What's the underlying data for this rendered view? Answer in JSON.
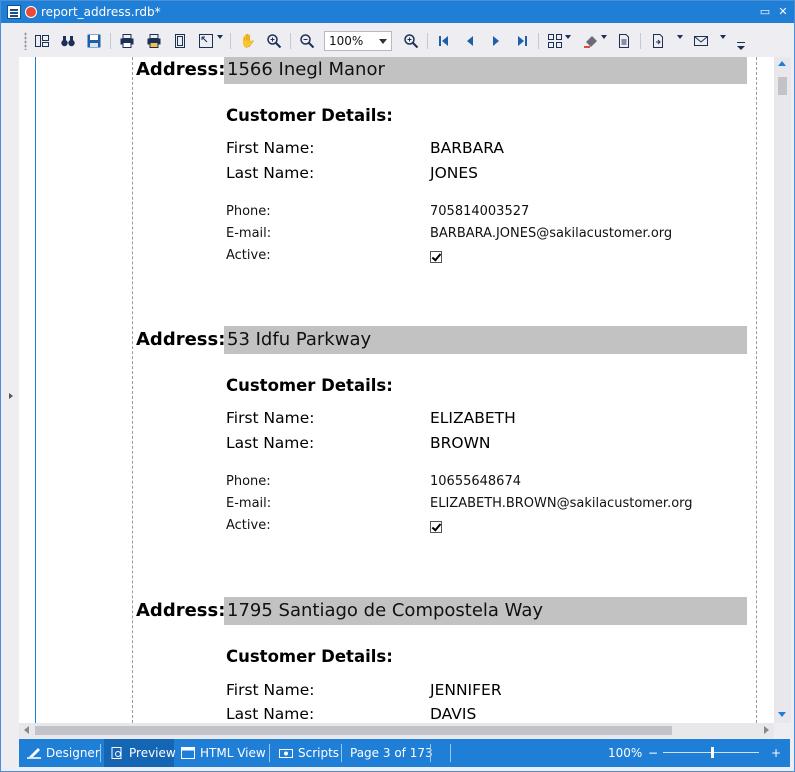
{
  "window": {
    "title": "report_address.rdb*",
    "minimize_glyph": "▭",
    "close_glyph": "✕"
  },
  "toolbar": {
    "icons": [
      "layout-icon",
      "find-icon",
      "save-icon",
      "print-icon",
      "quick-print-icon",
      "page-setup-icon",
      "fit-icon",
      "hand-tool-icon",
      "zoom-tool-icon",
      "zoom-out-icon",
      "zoom-in-icon",
      "first-page-icon",
      "previous-page-icon",
      "next-page-icon",
      "last-page-icon",
      "multi-page-icon",
      "background-color-icon",
      "watermark-icon",
      "export-icon",
      "send-email-icon"
    ],
    "zoom_value": "100%"
  },
  "report": {
    "records": [
      {
        "address_label": "Address:",
        "address": "1566 Inegl Manor",
        "customer_heading": "Customer Details:",
        "first_name_label": "First Name:",
        "first_name": "BARBARA",
        "last_name_label": "Last Name:",
        "last_name": "JONES",
        "phone_label": "Phone:",
        "phone": "705814003527",
        "email_label": "E-mail:",
        "email": "BARBARA.JONES@sakilacustomer.org",
        "active_label": "Active:",
        "active": true
      },
      {
        "address_label": "Address:",
        "address": "53 Idfu Parkway",
        "customer_heading": "Customer Details:",
        "first_name_label": "First Name:",
        "first_name": "ELIZABETH",
        "last_name_label": "Last Name:",
        "last_name": "BROWN",
        "phone_label": "Phone:",
        "phone": "10655648674",
        "email_label": "E-mail:",
        "email": "ELIZABETH.BROWN@sakilacustomer.org",
        "active_label": "Active:",
        "active": true
      },
      {
        "address_label": "Address:",
        "address": "1795 Santiago de Compostela Way",
        "customer_heading": "Customer Details:",
        "first_name_label": "First Name:",
        "first_name": "JENNIFER",
        "last_name_label": "Last Name:",
        "last_name": "DAVIS"
      }
    ]
  },
  "statusbar": {
    "designer": "Designer",
    "preview": "Preview",
    "html_view": "HTML View",
    "scripts": "Scripts",
    "page_info": "Page 3 of 173",
    "zoom": "100%",
    "zoom_minus": "−",
    "zoom_plus": "+"
  },
  "colors": {
    "accent": "#1f7fd6",
    "address_bar": "#c2c2c2",
    "close_dot": "#e84b3c"
  }
}
